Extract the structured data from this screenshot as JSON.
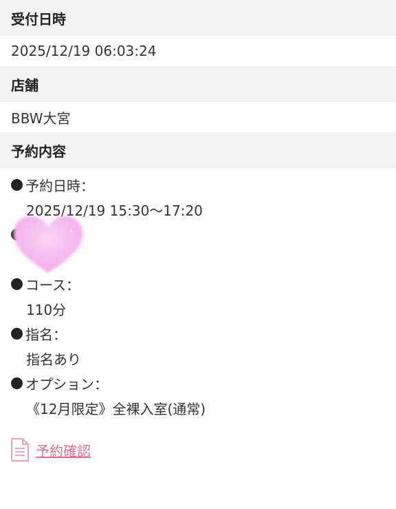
{
  "reception": {
    "header": "受付日時",
    "value": "2025/12/19 06:03:24"
  },
  "store": {
    "header": "店舗",
    "value": "BBW大宮"
  },
  "reservation": {
    "header": "予約内容",
    "items": [
      {
        "label": "予約日時：",
        "value": "2025/12/19 15:30〜17:20"
      },
      {
        "label": "コース：",
        "value": "110分"
      },
      {
        "label": "指名：",
        "value": "指名あり"
      },
      {
        "label": "オプション：",
        "value": "《12月限定》全裸入室(通常)"
      }
    ]
  },
  "confirm_link": {
    "label": "予約確認",
    "icon": "document-icon",
    "color": "#e0708f"
  },
  "sticker": {
    "icon": "heart-sticker",
    "color": "#f6b8ee"
  }
}
